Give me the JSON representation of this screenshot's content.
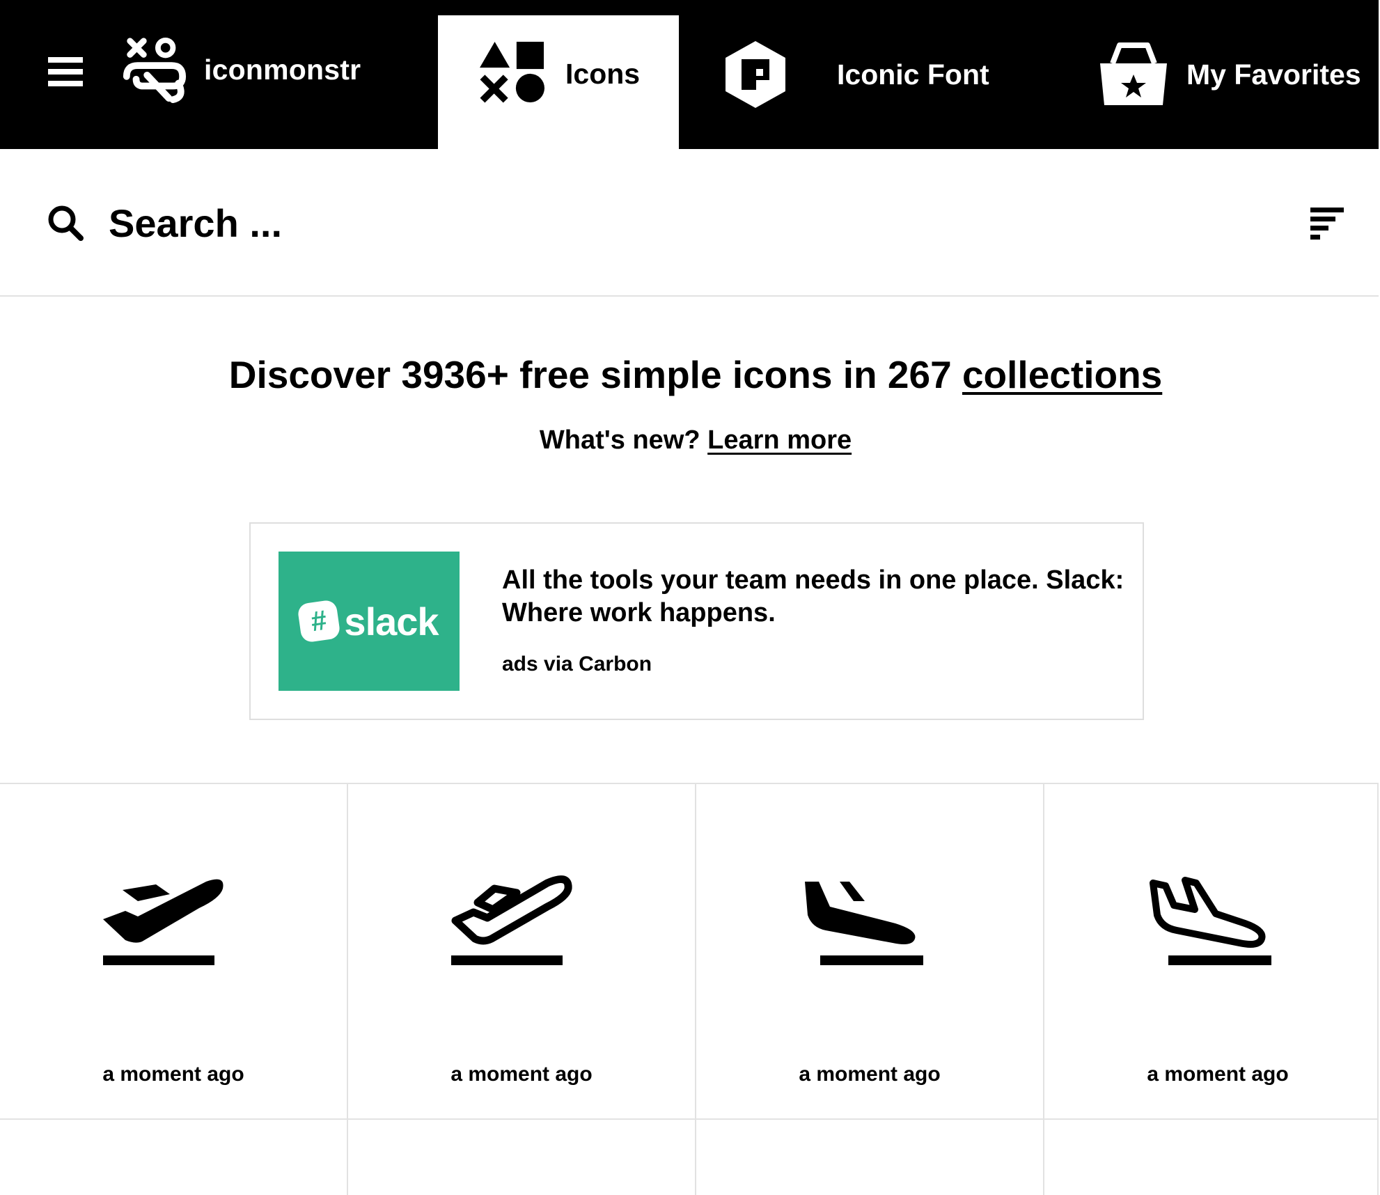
{
  "header": {
    "brand": "iconmonstr",
    "tabs": [
      {
        "label": "Icons",
        "icon": "shapes-icon",
        "active": true
      },
      {
        "label": "Iconic Font",
        "icon": "hexagon-font-icon",
        "active": false
      },
      {
        "label": "My Favorites",
        "icon": "basket-star-icon",
        "active": false
      }
    ]
  },
  "search": {
    "placeholder": "Search ..."
  },
  "hero": {
    "title_prefix": "Discover 3936+ free simple icons in 267 ",
    "title_link": "collections",
    "subtitle_prefix": "What's new? ",
    "subtitle_link": "Learn more"
  },
  "ad": {
    "logo_text": "slack",
    "logo_color": "#2eb28a",
    "text": "All the tools your team needs in one place. Slack: Where work happens.",
    "via": "ads via Carbon"
  },
  "icons": [
    {
      "name": "airplane-takeoff-filled-icon",
      "time": "a moment ago"
    },
    {
      "name": "airplane-takeoff-outline-icon",
      "time": "a moment ago"
    },
    {
      "name": "airplane-landing-filled-icon",
      "time": "a moment ago"
    },
    {
      "name": "airplane-landing-outline-icon",
      "time": "a moment ago"
    }
  ],
  "colors": {
    "topbar": "#000000",
    "background": "#ffffff",
    "divider": "#e2e2e2"
  }
}
